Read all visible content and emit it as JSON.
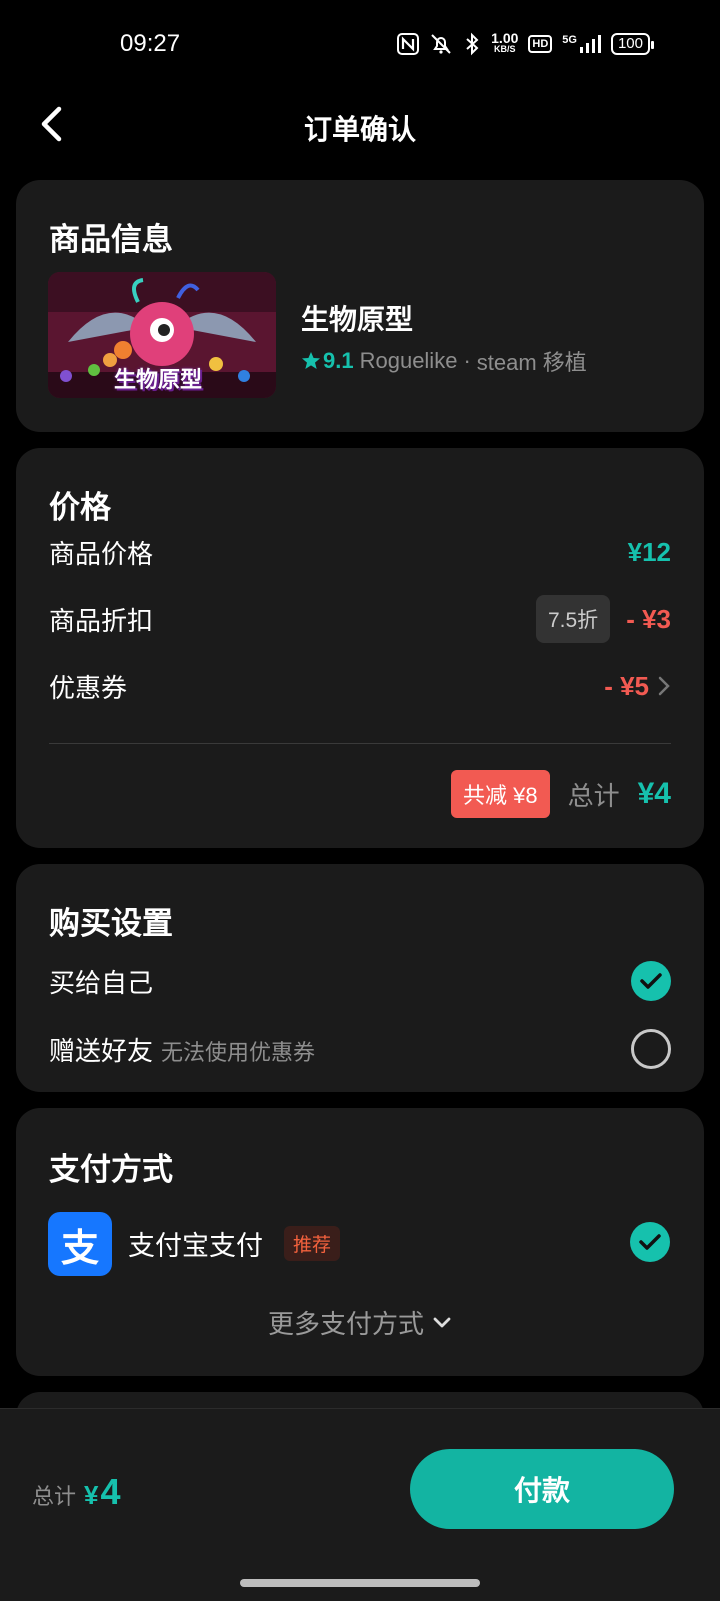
{
  "status_bar": {
    "time": "09:27",
    "speed_value": "1.00",
    "speed_unit": "KB/S",
    "hd": "HD",
    "network": "5G",
    "battery": "100",
    "icons": [
      "nfc-icon",
      "mute-icon",
      "bluetooth-icon",
      "signal-icon",
      "battery-icon"
    ]
  },
  "nav": {
    "title": "订单确认",
    "back_icon": "back-arrow-icon"
  },
  "product": {
    "section_title": "商品信息",
    "name": "生物原型",
    "thumb_caption": "生物原型",
    "rating": "9.1",
    "genre": "Roguelike",
    "separator": "·",
    "platform": "steam 移植"
  },
  "price": {
    "section_title": "价格",
    "item_price_label": "商品价格",
    "item_price_value": "¥12",
    "discount_label": "商品折扣",
    "discount_tag": "7.5折",
    "discount_value": "- ¥3",
    "coupon_label": "优惠券",
    "coupon_value": "- ¥5",
    "saved_badge": "共减 ¥8",
    "total_label": "总计",
    "total_value": "¥4"
  },
  "purchase_settings": {
    "section_title": "购买设置",
    "option_self": "买给自己",
    "option_self_selected": true,
    "option_gift": "赠送好友",
    "option_gift_note": "无法使用优惠券",
    "option_gift_selected": false
  },
  "payment": {
    "section_title": "支付方式",
    "alipay_glyph": "支",
    "alipay_label": "支付宝支付",
    "recommend_tag": "推荐",
    "alipay_selected": true,
    "more_label": "更多支付方式"
  },
  "bottom_bar": {
    "total_label": "总计",
    "currency": "¥",
    "total_amount": "4",
    "pay_button": "付款"
  },
  "colors": {
    "accent": "#16c1ad",
    "discount_red": "#f25a52",
    "card_bg": "#1b1b1b",
    "alipay_blue": "#1677ff"
  }
}
